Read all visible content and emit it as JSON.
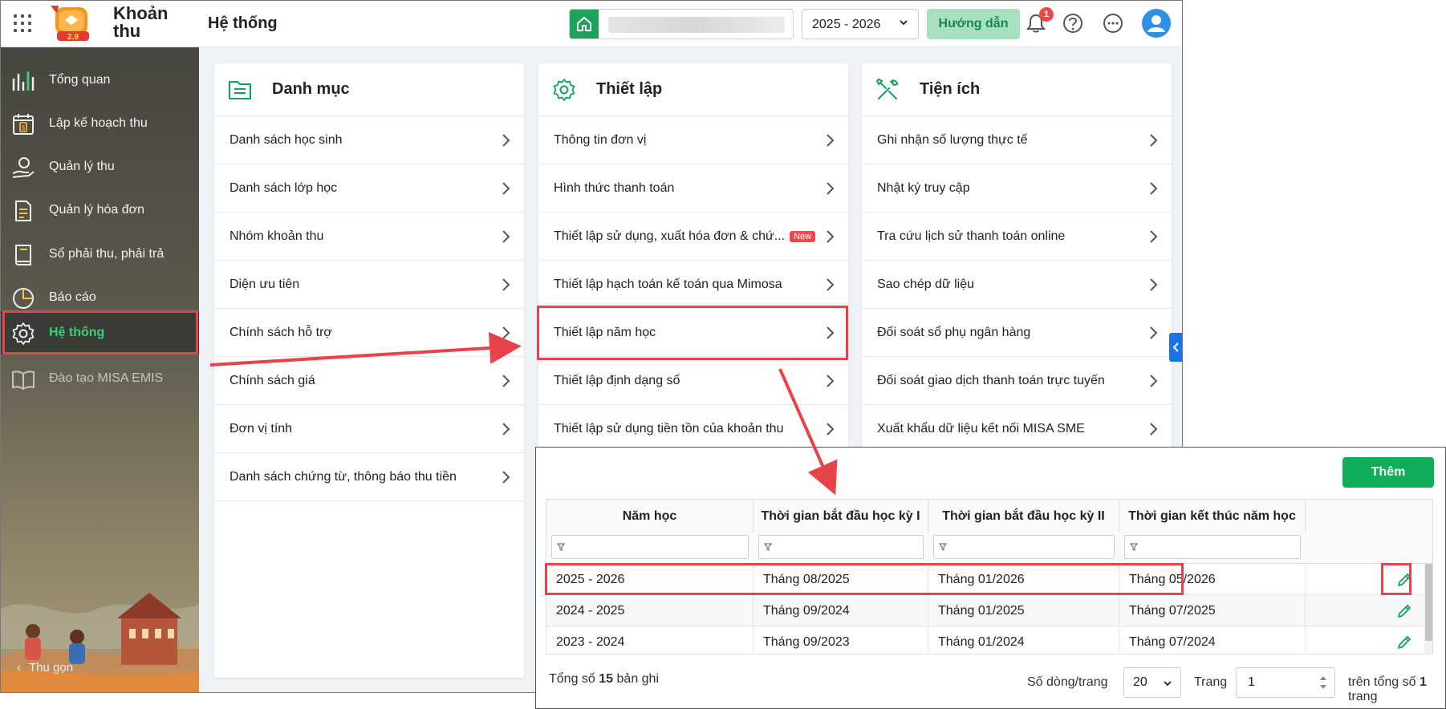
{
  "header": {
    "app_name": "Khoản thu",
    "page_title": "Hệ thống",
    "logo_version": "2.9",
    "school_year": "2025 - 2026",
    "guide_label": "Hướng dẫn",
    "notification_count": "1"
  },
  "sidebar": {
    "items": [
      {
        "label": "Tổng quan",
        "icon": "bar-chart-icon"
      },
      {
        "label": "Lập kế hoạch thu",
        "icon": "calendar-money-icon"
      },
      {
        "label": "Quản lý thu",
        "icon": "hand-coin-icon"
      },
      {
        "label": "Quản lý hóa đơn",
        "icon": "invoice-icon"
      },
      {
        "label": "Sổ phải thu, phải trả",
        "icon": "ledger-book-icon"
      },
      {
        "label": "Báo cáo",
        "icon": "pie-chart-icon"
      },
      {
        "label": "Hệ thống",
        "icon": "gear-icon",
        "active": true
      },
      {
        "label": "Đào tạo MISA EMIS",
        "icon": "open-book-icon"
      }
    ],
    "collapse_label": "Thu gọn"
  },
  "panels": {
    "catalog": {
      "title": "Danh mục",
      "items": [
        "Danh sách học sinh",
        "Danh sách lớp học",
        "Nhóm khoản thu",
        "Diện ưu tiên",
        "Chính sách hỗ trợ",
        "Chính sách giá",
        "Đơn vị tính",
        "Danh sách chứng từ, thông báo thu tiền"
      ]
    },
    "settings": {
      "title": "Thiết lập",
      "items": [
        "Thông tin đơn vị",
        "Hình thức thanh toán",
        "Thiết lập sử dụng, xuất hóa đơn & chứ...",
        "Thiết lập hạch toán kế toán qua Mimosa",
        "Thiết lập năm học",
        "Thiết lập định dạng số",
        "Thiết lập sử dụng tiền tồn của khoản thu"
      ],
      "new_badge": "New"
    },
    "utilities": {
      "title": "Tiện ích",
      "items": [
        "Ghi nhận số lượng thực tế",
        "Nhật ký truy cập",
        "Tra cứu lịch sử thanh toán online",
        "Sao chép dữ liệu",
        "Đối soát sổ phụ ngân hàng",
        "Đối soát giao dịch thanh toán trực tuyến",
        "Xuất khẩu dữ liệu kết nối MISA SME"
      ]
    }
  },
  "school_year_table": {
    "add_label": "Thêm",
    "columns": [
      "Năm học",
      "Thời gian bắt đầu học kỳ I",
      "Thời gian bắt đầu học kỳ II",
      "Thời gian kết thúc năm học"
    ],
    "rows": [
      [
        "2025 - 2026",
        "Tháng 08/2025",
        "Tháng 01/2026",
        "Tháng 05/2026"
      ],
      [
        "2024 - 2025",
        "Tháng 09/2024",
        "Tháng 01/2025",
        "Tháng 07/2025"
      ],
      [
        "2023 - 2024",
        "Tháng 09/2023",
        "Tháng 01/2024",
        "Tháng 07/2024"
      ]
    ],
    "footer": {
      "total_prefix": "Tổng số",
      "total_count": "15",
      "total_suffix": "bản ghi",
      "rows_per_page_label": "Số dòng/trang",
      "rows_per_page": "20",
      "page_label": "Trang",
      "page": "1",
      "of_pages_prefix": "trên tổng số",
      "total_pages": "1",
      "of_pages_suffix": "trang"
    }
  },
  "colors": {
    "accent_green": "#0fae5a",
    "highlight_red": "#e8434a",
    "sidebar_active_text": "#37d175",
    "toggle_blue": "#1a73e8"
  }
}
